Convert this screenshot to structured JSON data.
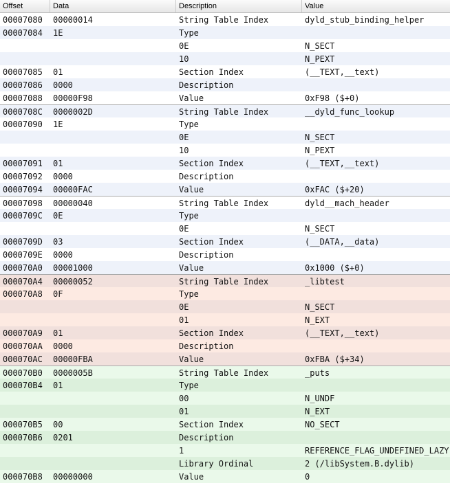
{
  "columns": [
    "Offset",
    "Data",
    "Description",
    "Value"
  ],
  "group_colors": {
    "white": [
      "#ffffff",
      "#eef2fa"
    ],
    "red": [
      "#f1e0dc",
      "#fdeae2"
    ],
    "green": [
      "#dcf0dc",
      "#eaf9ea"
    ]
  },
  "rows": [
    {
      "g": "white",
      "sep": false,
      "c": [
        "00007080",
        "00000014",
        "String Table Index",
        "dyld_stub_binding_helper"
      ]
    },
    {
      "g": "white",
      "sep": false,
      "c": [
        "00007084",
        "1E",
        "Type",
        ""
      ]
    },
    {
      "g": "white",
      "sep": false,
      "c": [
        "",
        "",
        "0E",
        "N_SECT"
      ]
    },
    {
      "g": "white",
      "sep": false,
      "c": [
        "",
        "",
        "10",
        "N_PEXT"
      ]
    },
    {
      "g": "white",
      "sep": false,
      "c": [
        "00007085",
        "01",
        "Section Index",
        "(__TEXT,__text)"
      ]
    },
    {
      "g": "white",
      "sep": false,
      "c": [
        "00007086",
        "0000",
        "Description",
        ""
      ]
    },
    {
      "g": "white",
      "sep": false,
      "c": [
        "00007088",
        "00000F98",
        "Value",
        "0xF98 ($+0)"
      ]
    },
    {
      "g": "white",
      "sep": true,
      "c": [
        "0000708C",
        "0000002D",
        "String Table Index",
        "__dyld_func_lookup"
      ]
    },
    {
      "g": "white",
      "sep": false,
      "c": [
        "00007090",
        "1E",
        "Type",
        ""
      ]
    },
    {
      "g": "white",
      "sep": false,
      "c": [
        "",
        "",
        "0E",
        "N_SECT"
      ]
    },
    {
      "g": "white",
      "sep": false,
      "c": [
        "",
        "",
        "10",
        "N_PEXT"
      ]
    },
    {
      "g": "white",
      "sep": false,
      "c": [
        "00007091",
        "01",
        "Section Index",
        "(__TEXT,__text)"
      ]
    },
    {
      "g": "white",
      "sep": false,
      "c": [
        "00007092",
        "0000",
        "Description",
        ""
      ]
    },
    {
      "g": "white",
      "sep": false,
      "c": [
        "00007094",
        "00000FAC",
        "Value",
        "0xFAC ($+20)"
      ]
    },
    {
      "g": "white",
      "sep": true,
      "c": [
        "00007098",
        "00000040",
        "String Table Index",
        "dyld__mach_header"
      ]
    },
    {
      "g": "white",
      "sep": false,
      "c": [
        "0000709C",
        "0E",
        "Type",
        ""
      ]
    },
    {
      "g": "white",
      "sep": false,
      "c": [
        "",
        "",
        "0E",
        "N_SECT"
      ]
    },
    {
      "g": "white",
      "sep": false,
      "c": [
        "0000709D",
        "03",
        "Section Index",
        "(__DATA,__data)"
      ]
    },
    {
      "g": "white",
      "sep": false,
      "c": [
        "0000709E",
        "0000",
        "Description",
        ""
      ]
    },
    {
      "g": "white",
      "sep": false,
      "c": [
        "000070A0",
        "00001000",
        "Value",
        "0x1000 ($+0)"
      ]
    },
    {
      "g": "red",
      "sep": true,
      "c": [
        "000070A4",
        "00000052",
        "String Table Index",
        "_libtest"
      ]
    },
    {
      "g": "red",
      "sep": false,
      "c": [
        "000070A8",
        "0F",
        "Type",
        ""
      ]
    },
    {
      "g": "red",
      "sep": false,
      "c": [
        "",
        "",
        "0E",
        "N_SECT"
      ]
    },
    {
      "g": "red",
      "sep": false,
      "c": [
        "",
        "",
        "01",
        "N_EXT"
      ]
    },
    {
      "g": "red",
      "sep": false,
      "c": [
        "000070A9",
        "01",
        "Section Index",
        "(__TEXT,__text)"
      ]
    },
    {
      "g": "red",
      "sep": false,
      "c": [
        "000070AA",
        "0000",
        "Description",
        ""
      ]
    },
    {
      "g": "red",
      "sep": false,
      "c": [
        "000070AC",
        "00000FBA",
        "Value",
        "0xFBA ($+34)"
      ]
    },
    {
      "g": "green",
      "sep": true,
      "c": [
        "000070B0",
        "0000005B",
        "String Table Index",
        "_puts"
      ]
    },
    {
      "g": "green",
      "sep": false,
      "c": [
        "000070B4",
        "01",
        "Type",
        ""
      ]
    },
    {
      "g": "green",
      "sep": false,
      "c": [
        "",
        "",
        "00",
        "N_UNDF"
      ]
    },
    {
      "g": "green",
      "sep": false,
      "c": [
        "",
        "",
        "01",
        "N_EXT"
      ]
    },
    {
      "g": "green",
      "sep": false,
      "c": [
        "000070B5",
        "00",
        "Section Index",
        "NO_SECT"
      ]
    },
    {
      "g": "green",
      "sep": false,
      "c": [
        "000070B6",
        "0201",
        "Description",
        ""
      ]
    },
    {
      "g": "green",
      "sep": false,
      "c": [
        "",
        "",
        "1",
        "REFERENCE_FLAG_UNDEFINED_LAZY"
      ]
    },
    {
      "g": "green",
      "sep": false,
      "c": [
        "",
        "",
        "Library Ordinal",
        "2 (/libSystem.B.dylib)"
      ]
    },
    {
      "g": "green",
      "sep": false,
      "c": [
        "000070B8",
        "00000000",
        "Value",
        "0"
      ]
    }
  ]
}
